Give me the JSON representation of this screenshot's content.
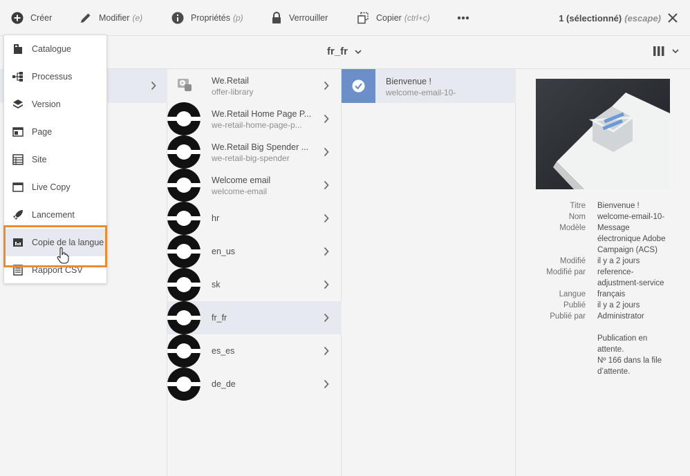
{
  "toolbar": {
    "create_label": "Créer",
    "edit_label": "Modifier",
    "edit_hint": "(e)",
    "properties_label": "Propriétés",
    "properties_hint": "(p)",
    "lock_label": "Verrouiller",
    "copy_label": "Copier",
    "copy_hint": "(ctrl+c)",
    "selection_text": "1 (sélectionné)",
    "escape_hint": "(escape)"
  },
  "titlebar": {
    "title": "fr_fr"
  },
  "create_menu": {
    "items": [
      {
        "label": "Catalogue",
        "icon": "catalog-icon"
      },
      {
        "label": "Processus",
        "icon": "workflow-icon"
      },
      {
        "label": "Version",
        "icon": "layers-icon"
      },
      {
        "label": "Page",
        "icon": "page-icon"
      },
      {
        "label": "Site",
        "icon": "site-icon"
      },
      {
        "label": "Live Copy",
        "icon": "live-copy-icon"
      },
      {
        "label": "Lancement",
        "icon": "launch-icon"
      },
      {
        "label": "Copie de la langue",
        "icon": "language-copy-icon"
      },
      {
        "label": "Rapport CSV",
        "icon": "csv-report-icon"
      }
    ]
  },
  "column1": {
    "items": [
      {
        "title": "We.Retail",
        "subtitle": "offer-library"
      },
      {
        "title": "We.Retail Home Page P...",
        "subtitle": "we-retail-home-page-p..."
      },
      {
        "title": "We.Retail Big Spender ...",
        "subtitle": "we-retail-big-spender"
      },
      {
        "title": "Welcome email",
        "subtitle": "welcome-email"
      },
      {
        "title": "hr",
        "subtitle": ""
      },
      {
        "title": "en_us",
        "subtitle": ""
      },
      {
        "title": "sk",
        "subtitle": ""
      },
      {
        "title": "fr_fr",
        "subtitle": ""
      },
      {
        "title": "es_es",
        "subtitle": ""
      },
      {
        "title": "de_de",
        "subtitle": ""
      }
    ]
  },
  "column2": {
    "items": [
      {
        "title": "Bienvenue !",
        "subtitle": "welcome-email-10-"
      }
    ]
  },
  "details": {
    "rows": [
      {
        "key": "Titre",
        "value": "Bienvenue !"
      },
      {
        "key": "Nom",
        "value": "welcome-email-10-"
      },
      {
        "key": "Modèle",
        "value": "Message électronique Adobe Campaign (ACS)"
      },
      {
        "key": "Modifié",
        "value": "il y a 2 jours"
      },
      {
        "key": "Modifié par",
        "value": "reference-adjustment-service"
      },
      {
        "key": "Langue",
        "value": "français"
      },
      {
        "key": "Publié",
        "value": "il y a 2 jours"
      },
      {
        "key": "Publié par",
        "value": "Administrator"
      }
    ],
    "status": "Publication en attente.",
    "queue": "Nº 166 dans la file d’attente."
  },
  "colors": {
    "highlight_border": "#f08a2b",
    "selected_row": "#e6e9ef",
    "email_thumb": "#6b8fc9"
  }
}
